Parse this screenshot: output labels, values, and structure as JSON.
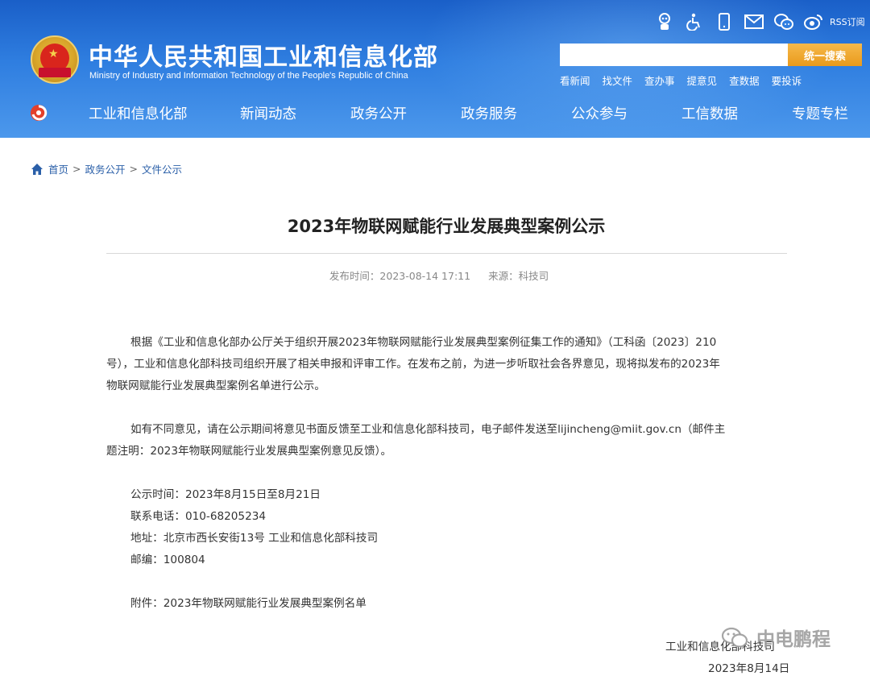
{
  "header": {
    "title_cn": "中华人民共和国工业和信息化部",
    "title_en": "Ministry of Industry and Information Technology of the People's Republic of China",
    "icons": [
      "robot-icon",
      "accessibility-icon",
      "mobile-icon",
      "mail-icon",
      "wechat-icon",
      "weibo-icon"
    ],
    "rss_label": "RSS订阅",
    "search_value": "",
    "search_button": "统一搜索",
    "quick_links": [
      "看新闻",
      "找文件",
      "查办事",
      "提意见",
      "查数据",
      "要投诉"
    ]
  },
  "nav": {
    "items": [
      "工业和信息化部",
      "新闻动态",
      "政务公开",
      "政务服务",
      "公众参与",
      "工信数据",
      "专题专栏"
    ]
  },
  "breadcrumb": [
    "首页",
    "政务公开",
    "文件公示"
  ],
  "breadcrumb_sep": ">",
  "article": {
    "title": "2023年物联网赋能行业发展典型案例公示",
    "date_label": "发布时间：2023-08-14 17:11",
    "source_label": "来源：科技司",
    "para1_l1": "根据《工业和信息化部办公厅关于组织开展2023年物联网赋能行业发展典型案例征集工作的通知》（工科函〔2023〕210",
    "para1_l2": "号），工业和信息化部科技司组织开展了相关申报和评审工作。在发布之前，为进一步听取社会各界意见，现将拟发布的2023年",
    "para1_l3": "物联网赋能行业发展典型案例名单进行公示。",
    "para2_l1": "如有不同意见，请在公示期间将意见书面反馈至工业和信息化部科技司，电子邮件发送至lijincheng@miit.gov.cn（邮件主",
    "para2_l2": "题注明：2023年物联网赋能行业发展典型案例意见反馈）。",
    "period": "公示时间：2023年8月15日至8月21日",
    "phone": "联系电话：010-68205234",
    "address": "地址：北京市西长安街13号 工业和信息化部科技司",
    "postcode": "邮编：100804",
    "attachment": "附件：2023年物联网赋能行业发展典型案例名单",
    "sign_org": "工业和信息化部科技司",
    "sign_date": "2023年8月14日"
  },
  "watermark": "中电鹏程",
  "colors": {
    "header_blue": "#2f7ee0",
    "search_orange": "#e99a1c",
    "link_blue": "#2a5fa8"
  }
}
